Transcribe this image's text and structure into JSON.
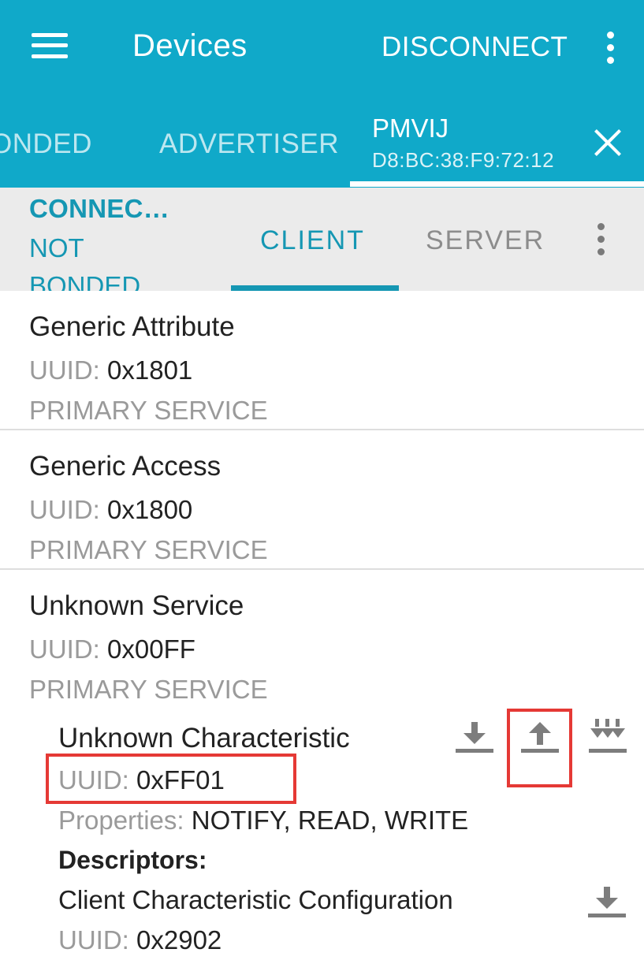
{
  "app_bar": {
    "title": "Devices",
    "action": "DISCONNECT",
    "menu_icon": "hamburger-menu-icon",
    "overflow_icon": "more-vert-icon"
  },
  "tabs": {
    "bonded_partial": "ONDED",
    "advertiser": "ADVERTISER",
    "device": {
      "name": "PMVIJ",
      "mac": "D8:BC:38:F9:72:12"
    },
    "close_icon": "close-icon"
  },
  "sub_bar": {
    "status_line1": "CONNEC…",
    "status_line2": "NOT",
    "status_line3": "BONDED",
    "client": "CLIENT",
    "server": "SERVER"
  },
  "services": [
    {
      "name": "Generic Attribute",
      "uuid_label": "UUID:",
      "uuid": "0x1801",
      "type": "PRIMARY SERVICE"
    },
    {
      "name": "Generic Access",
      "uuid_label": "UUID:",
      "uuid": "0x1800",
      "type": "PRIMARY SERVICE"
    },
    {
      "name": "Unknown Service",
      "uuid_label": "UUID:",
      "uuid": "0x00FF",
      "type": "PRIMARY SERVICE"
    }
  ],
  "characteristic": {
    "name": "Unknown Characteristic",
    "uuid_label": "UUID:",
    "uuid": "0xFF01",
    "properties_label": "Properties:",
    "properties": "NOTIFY, READ, WRITE",
    "descriptors_label": "Descriptors:",
    "descriptor": {
      "name": "Client Characteristic Configuration",
      "uuid_label": "UUID:",
      "uuid": "0x2902"
    },
    "icons": [
      "read-icon",
      "write-icon",
      "notify-icon"
    ]
  },
  "colors": {
    "primary": "#10a9c9",
    "accent": "#1597b3",
    "highlight": "#e53935"
  }
}
